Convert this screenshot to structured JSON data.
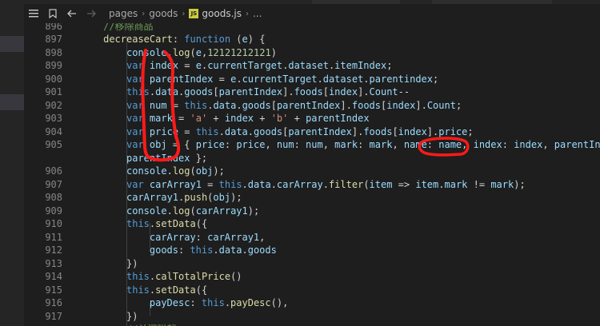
{
  "toolbar": {
    "breadcrumbs": [
      {
        "label": "pages",
        "icon": null
      },
      {
        "label": "goods",
        "icon": null
      },
      {
        "label": "goods.js",
        "icon": "js-file-icon"
      },
      {
        "label": "...",
        "icon": null
      }
    ],
    "icons": [
      "list-icon",
      "bookmark-icon",
      "back-arrow-icon",
      "forward-arrow-icon"
    ]
  },
  "editor": {
    "lines": [
      {
        "num": "896",
        "indent": 4,
        "tokens": [
          [
            "comment",
            "//移除商品"
          ]
        ]
      },
      {
        "num": "897",
        "indent": 4,
        "tokens": [
          [
            "func",
            "decreaseCart"
          ],
          [
            "punct",
            ": "
          ],
          [
            "keyword",
            "function"
          ],
          [
            "punct",
            " ("
          ],
          [
            "ident",
            "e"
          ],
          [
            "punct",
            ") {"
          ]
        ]
      },
      {
        "num": "898",
        "indent": 8,
        "tokens": [
          [
            "ident",
            "console"
          ],
          [
            "punct",
            "."
          ],
          [
            "func",
            "log"
          ],
          [
            "punct",
            "("
          ],
          [
            "ident",
            "e"
          ],
          [
            "punct",
            ","
          ],
          [
            "num",
            "12121212121"
          ],
          [
            "punct",
            ")"
          ]
        ]
      },
      {
        "num": "899",
        "indent": 8,
        "tokens": [
          [
            "keyword",
            "var"
          ],
          [
            "punct",
            " "
          ],
          [
            "ident",
            "index"
          ],
          [
            "punct",
            " = "
          ],
          [
            "ident",
            "e"
          ],
          [
            "punct",
            "."
          ],
          [
            "prop",
            "currentTarget"
          ],
          [
            "punct",
            "."
          ],
          [
            "prop",
            "dataset"
          ],
          [
            "punct",
            "."
          ],
          [
            "prop",
            "itemIndex"
          ],
          [
            "punct",
            ";"
          ]
        ]
      },
      {
        "num": "900",
        "indent": 8,
        "tokens": [
          [
            "keyword",
            "var"
          ],
          [
            "punct",
            " "
          ],
          [
            "ident",
            "parentIndex"
          ],
          [
            "punct",
            " = "
          ],
          [
            "ident",
            "e"
          ],
          [
            "punct",
            "."
          ],
          [
            "prop",
            "currentTarget"
          ],
          [
            "punct",
            "."
          ],
          [
            "prop",
            "dataset"
          ],
          [
            "punct",
            "."
          ],
          [
            "prop",
            "parentindex"
          ],
          [
            "punct",
            ";"
          ]
        ]
      },
      {
        "num": "901",
        "indent": 8,
        "tokens": [
          [
            "keyword",
            "this"
          ],
          [
            "punct",
            "."
          ],
          [
            "prop",
            "data"
          ],
          [
            "punct",
            "."
          ],
          [
            "prop",
            "goods"
          ],
          [
            "punct",
            "["
          ],
          [
            "ident",
            "parentIndex"
          ],
          [
            "punct",
            "]."
          ],
          [
            "prop",
            "foods"
          ],
          [
            "punct",
            "["
          ],
          [
            "ident",
            "index"
          ],
          [
            "punct",
            "]."
          ],
          [
            "prop",
            "Count"
          ],
          [
            "punct",
            "--"
          ]
        ]
      },
      {
        "num": "902",
        "indent": 8,
        "tokens": [
          [
            "keyword",
            "var"
          ],
          [
            "punct",
            " "
          ],
          [
            "ident",
            "num"
          ],
          [
            "punct",
            " = "
          ],
          [
            "keyword",
            "this"
          ],
          [
            "punct",
            "."
          ],
          [
            "prop",
            "data"
          ],
          [
            "punct",
            "."
          ],
          [
            "prop",
            "goods"
          ],
          [
            "punct",
            "["
          ],
          [
            "ident",
            "parentIndex"
          ],
          [
            "punct",
            "]."
          ],
          [
            "prop",
            "foods"
          ],
          [
            "punct",
            "["
          ],
          [
            "ident",
            "index"
          ],
          [
            "punct",
            "]."
          ],
          [
            "prop",
            "Count"
          ],
          [
            "punct",
            ";"
          ]
        ]
      },
      {
        "num": "903",
        "indent": 8,
        "tokens": [
          [
            "keyword",
            "var"
          ],
          [
            "punct",
            " "
          ],
          [
            "ident",
            "mark"
          ],
          [
            "punct",
            " = "
          ],
          [
            "str",
            "'a'"
          ],
          [
            "punct",
            " + "
          ],
          [
            "ident",
            "index"
          ],
          [
            "punct",
            " + "
          ],
          [
            "str",
            "'b'"
          ],
          [
            "punct",
            " + "
          ],
          [
            "ident",
            "parentIndex"
          ]
        ]
      },
      {
        "num": "904",
        "indent": 8,
        "tokens": [
          [
            "keyword",
            "var"
          ],
          [
            "punct",
            " "
          ],
          [
            "ident",
            "price"
          ],
          [
            "punct",
            " = "
          ],
          [
            "keyword",
            "this"
          ],
          [
            "punct",
            "."
          ],
          [
            "prop",
            "data"
          ],
          [
            "punct",
            "."
          ],
          [
            "prop",
            "goods"
          ],
          [
            "punct",
            "["
          ],
          [
            "ident",
            "parentIndex"
          ],
          [
            "punct",
            "]."
          ],
          [
            "prop",
            "foods"
          ],
          [
            "punct",
            "["
          ],
          [
            "ident",
            "index"
          ],
          [
            "punct",
            "]."
          ],
          [
            "prop",
            "price"
          ],
          [
            "punct",
            ";"
          ]
        ]
      },
      {
        "num": "905",
        "indent": 8,
        "tokens": [
          [
            "keyword",
            "var"
          ],
          [
            "punct",
            " "
          ],
          [
            "ident",
            "obj"
          ],
          [
            "punct",
            " = { "
          ],
          [
            "prop",
            "price"
          ],
          [
            "punct",
            ": "
          ],
          [
            "ident",
            "price"
          ],
          [
            "punct",
            ", "
          ],
          [
            "prop",
            "num"
          ],
          [
            "punct",
            ": "
          ],
          [
            "ident",
            "num"
          ],
          [
            "punct",
            ", "
          ],
          [
            "prop",
            "mark"
          ],
          [
            "punct",
            ": "
          ],
          [
            "ident",
            "mark"
          ],
          [
            "punct",
            ", "
          ],
          [
            "prop",
            "name"
          ],
          [
            "punct",
            ": "
          ],
          [
            "ident",
            "name"
          ],
          [
            "punct",
            ", "
          ],
          [
            "prop",
            "index"
          ],
          [
            "punct",
            ": "
          ],
          [
            "ident",
            "index"
          ],
          [
            "punct",
            ", "
          ],
          [
            "prop",
            "parentIndex"
          ]
        ]
      },
      {
        "num": "",
        "indent": 8,
        "tokens": [
          [
            "ident",
            "parentIndex"
          ],
          [
            "punct",
            " };"
          ]
        ]
      },
      {
        "num": "906",
        "indent": 8,
        "tokens": [
          [
            "ident",
            "console"
          ],
          [
            "punct",
            "."
          ],
          [
            "func",
            "log"
          ],
          [
            "punct",
            "("
          ],
          [
            "ident",
            "obj"
          ],
          [
            "punct",
            ");"
          ]
        ]
      },
      {
        "num": "907",
        "indent": 8,
        "tokens": [
          [
            "keyword",
            "var"
          ],
          [
            "punct",
            " "
          ],
          [
            "ident",
            "carArray1"
          ],
          [
            "punct",
            " = "
          ],
          [
            "keyword",
            "this"
          ],
          [
            "punct",
            "."
          ],
          [
            "prop",
            "data"
          ],
          [
            "punct",
            "."
          ],
          [
            "prop",
            "carArray"
          ],
          [
            "punct",
            "."
          ],
          [
            "func",
            "filter"
          ],
          [
            "punct",
            "("
          ],
          [
            "ident",
            "item"
          ],
          [
            "punct",
            " => "
          ],
          [
            "ident",
            "item"
          ],
          [
            "punct",
            "."
          ],
          [
            "prop",
            "mark"
          ],
          [
            "punct",
            " != "
          ],
          [
            "ident",
            "mark"
          ],
          [
            "punct",
            ");"
          ]
        ]
      },
      {
        "num": "908",
        "indent": 8,
        "tokens": [
          [
            "ident",
            "carArray1"
          ],
          [
            "punct",
            "."
          ],
          [
            "func",
            "push"
          ],
          [
            "punct",
            "("
          ],
          [
            "ident",
            "obj"
          ],
          [
            "punct",
            ");"
          ]
        ]
      },
      {
        "num": "909",
        "indent": 8,
        "tokens": [
          [
            "ident",
            "console"
          ],
          [
            "punct",
            "."
          ],
          [
            "func",
            "log"
          ],
          [
            "punct",
            "("
          ],
          [
            "ident",
            "carArray1"
          ],
          [
            "punct",
            ");"
          ]
        ]
      },
      {
        "num": "910",
        "indent": 8,
        "tokens": [
          [
            "keyword",
            "this"
          ],
          [
            "punct",
            "."
          ],
          [
            "func",
            "setData"
          ],
          [
            "punct",
            "({"
          ]
        ]
      },
      {
        "num": "911",
        "indent": 12,
        "tokens": [
          [
            "prop",
            "carArray"
          ],
          [
            "punct",
            ": "
          ],
          [
            "ident",
            "carArray1"
          ],
          [
            "punct",
            ","
          ]
        ]
      },
      {
        "num": "912",
        "indent": 12,
        "tokens": [
          [
            "prop",
            "goods"
          ],
          [
            "punct",
            ": "
          ],
          [
            "keyword",
            "this"
          ],
          [
            "punct",
            "."
          ],
          [
            "prop",
            "data"
          ],
          [
            "punct",
            "."
          ],
          [
            "prop",
            "goods"
          ]
        ]
      },
      {
        "num": "913",
        "indent": 8,
        "tokens": [
          [
            "punct",
            "})"
          ]
        ]
      },
      {
        "num": "914",
        "indent": 8,
        "tokens": [
          [
            "keyword",
            "this"
          ],
          [
            "punct",
            "."
          ],
          [
            "func",
            "calTotalPrice"
          ],
          [
            "punct",
            "()"
          ]
        ]
      },
      {
        "num": "915",
        "indent": 8,
        "tokens": [
          [
            "keyword",
            "this"
          ],
          [
            "punct",
            "."
          ],
          [
            "func",
            "setData"
          ],
          [
            "punct",
            "({"
          ]
        ]
      },
      {
        "num": "916",
        "indent": 12,
        "tokens": [
          [
            "prop",
            "payDesc"
          ],
          [
            "punct",
            ": "
          ],
          [
            "keyword",
            "this"
          ],
          [
            "punct",
            "."
          ],
          [
            "func",
            "payDesc"
          ],
          [
            "punct",
            "(),"
          ]
        ]
      },
      {
        "num": "917",
        "indent": 8,
        "tokens": [
          [
            "punct",
            "})"
          ]
        ]
      },
      {
        "num": "",
        "indent": 8,
        "tokens": [
          [
            "comment",
            "//关闭弹起"
          ]
        ]
      }
    ]
  },
  "annotation": {
    "color": "#ff1a1a"
  }
}
